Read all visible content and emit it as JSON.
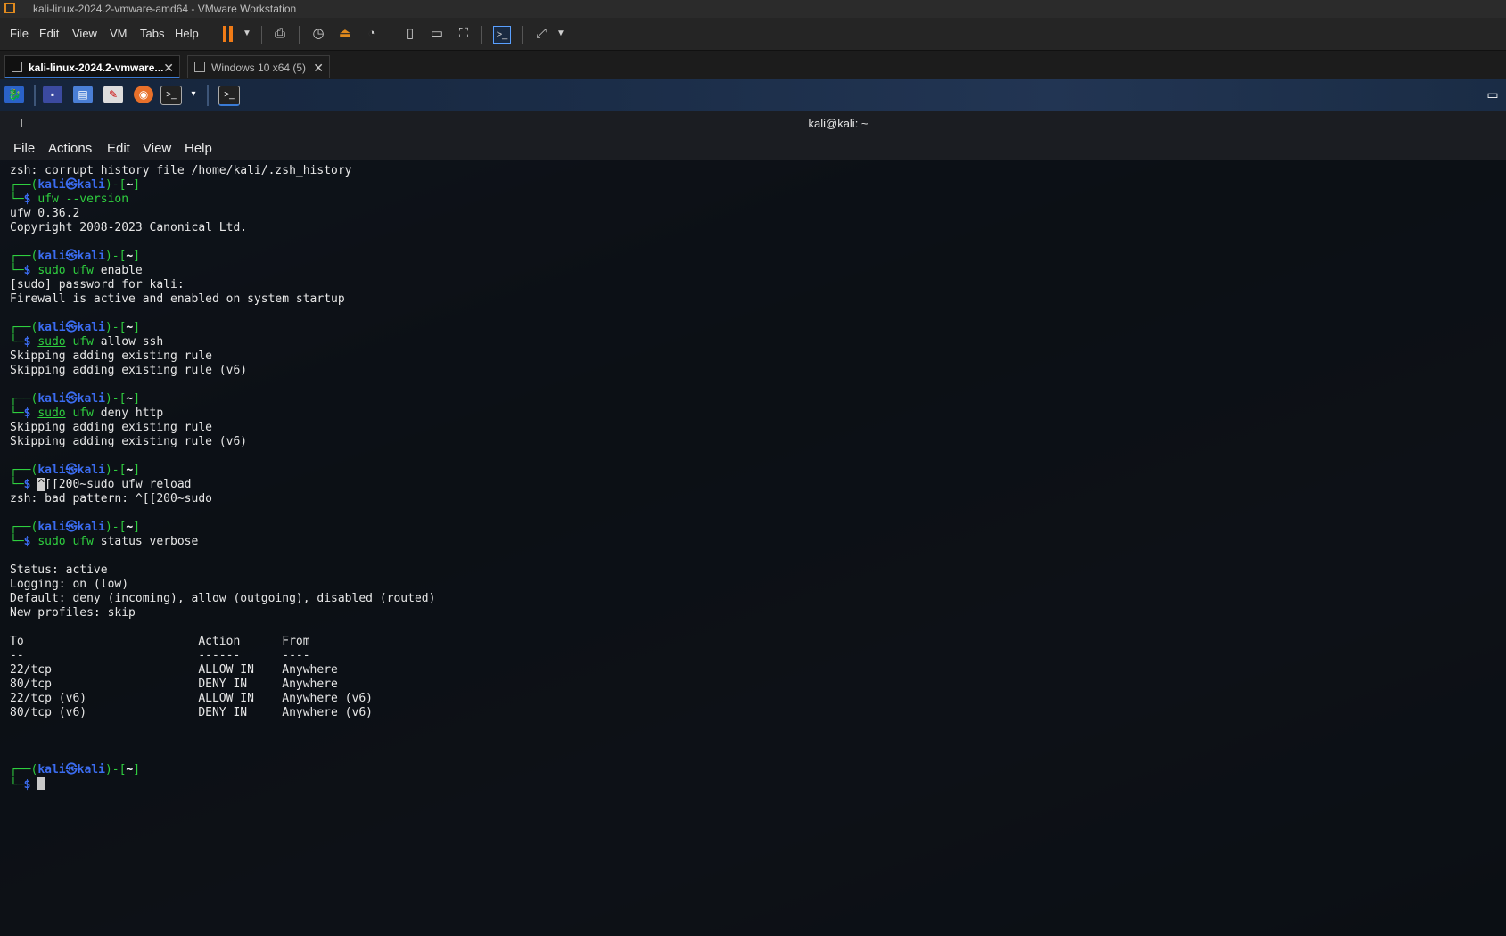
{
  "window": {
    "title": "kali-linux-2024.2-vmware-amd64 - VMware Workstation"
  },
  "vmware_menu": [
    "File",
    "Edit",
    "View",
    "VM",
    "Tabs",
    "Help"
  ],
  "tabs": [
    {
      "label": "kali-linux-2024.2-vmware...",
      "active": true
    },
    {
      "label": "Windows 10 x64 (5)",
      "active": false
    }
  ],
  "terminal": {
    "title": "kali@kali: ~",
    "menu": [
      "File",
      "Actions",
      "Edit",
      "View",
      "Help"
    ],
    "prompt": {
      "top_open": "┌──(",
      "user": "kali",
      "at": "㉿",
      "host": "kali",
      "mid": ")-[",
      "dir": "~",
      "top_close": "]",
      "bottom": "└─$ "
    },
    "lines": [
      {
        "type": "out",
        "text": "zsh: corrupt history file /home/kali/.zsh_history"
      },
      {
        "type": "prompt"
      },
      {
        "type": "cmd",
        "sudo": "",
        "prog": "ufw",
        "args": " --version"
      },
      {
        "type": "out",
        "text": "ufw 0.36.2"
      },
      {
        "type": "out",
        "text": "Copyright 2008-2023 Canonical Ltd."
      },
      {
        "type": "out",
        "text": ""
      },
      {
        "type": "prompt"
      },
      {
        "type": "cmd",
        "sudo": "sudo",
        "prog": "ufw",
        "args": " enable"
      },
      {
        "type": "out",
        "text": "[sudo] password for kali: "
      },
      {
        "type": "out",
        "text": "Firewall is active and enabled on system startup"
      },
      {
        "type": "out",
        "text": ""
      },
      {
        "type": "prompt"
      },
      {
        "type": "cmd",
        "sudo": "sudo",
        "prog": "ufw",
        "args": " allow ssh"
      },
      {
        "type": "out",
        "text": "Skipping adding existing rule"
      },
      {
        "type": "out",
        "text": "Skipping adding existing rule (v6)"
      },
      {
        "type": "out",
        "text": ""
      },
      {
        "type": "prompt"
      },
      {
        "type": "cmd",
        "sudo": "sudo",
        "prog": "ufw",
        "args": " deny http"
      },
      {
        "type": "out",
        "text": "Skipping adding existing rule"
      },
      {
        "type": "out",
        "text": "Skipping adding existing rule (v6)"
      },
      {
        "type": "out",
        "text": ""
      },
      {
        "type": "prompt"
      },
      {
        "type": "raw",
        "text": "^[[200~sudo ufw reload"
      },
      {
        "type": "out",
        "text": "zsh: bad pattern: ^[[200~sudo"
      },
      {
        "type": "out",
        "text": ""
      },
      {
        "type": "prompt"
      },
      {
        "type": "cmd",
        "sudo": "sudo",
        "prog": "ufw",
        "args": " status verbose"
      },
      {
        "type": "out",
        "text": ""
      },
      {
        "type": "out",
        "text": "Status: active"
      },
      {
        "type": "out",
        "text": "Logging: on (low)"
      },
      {
        "type": "out",
        "text": "Default: deny (incoming), allow (outgoing), disabled (routed)"
      },
      {
        "type": "out",
        "text": "New profiles: skip"
      },
      {
        "type": "out",
        "text": ""
      },
      {
        "type": "out",
        "text": "To                         Action      From"
      },
      {
        "type": "out",
        "text": "--                         ------      ----"
      },
      {
        "type": "out",
        "text": "22/tcp                     ALLOW IN    Anywhere"
      },
      {
        "type": "out",
        "text": "80/tcp                     DENY IN     Anywhere"
      },
      {
        "type": "out",
        "text": "22/tcp (v6)                ALLOW IN    Anywhere (v6)"
      },
      {
        "type": "out",
        "text": "80/tcp (v6)                DENY IN     Anywhere (v6)"
      },
      {
        "type": "out",
        "text": ""
      },
      {
        "type": "out",
        "text": ""
      },
      {
        "type": "out",
        "text": ""
      },
      {
        "type": "prompt"
      },
      {
        "type": "cursor"
      }
    ]
  },
  "colors": {
    "prompt_green": "#2fcf3f",
    "prompt_blue": "#3b6cf0",
    "pause_orange": "#f07b16"
  }
}
